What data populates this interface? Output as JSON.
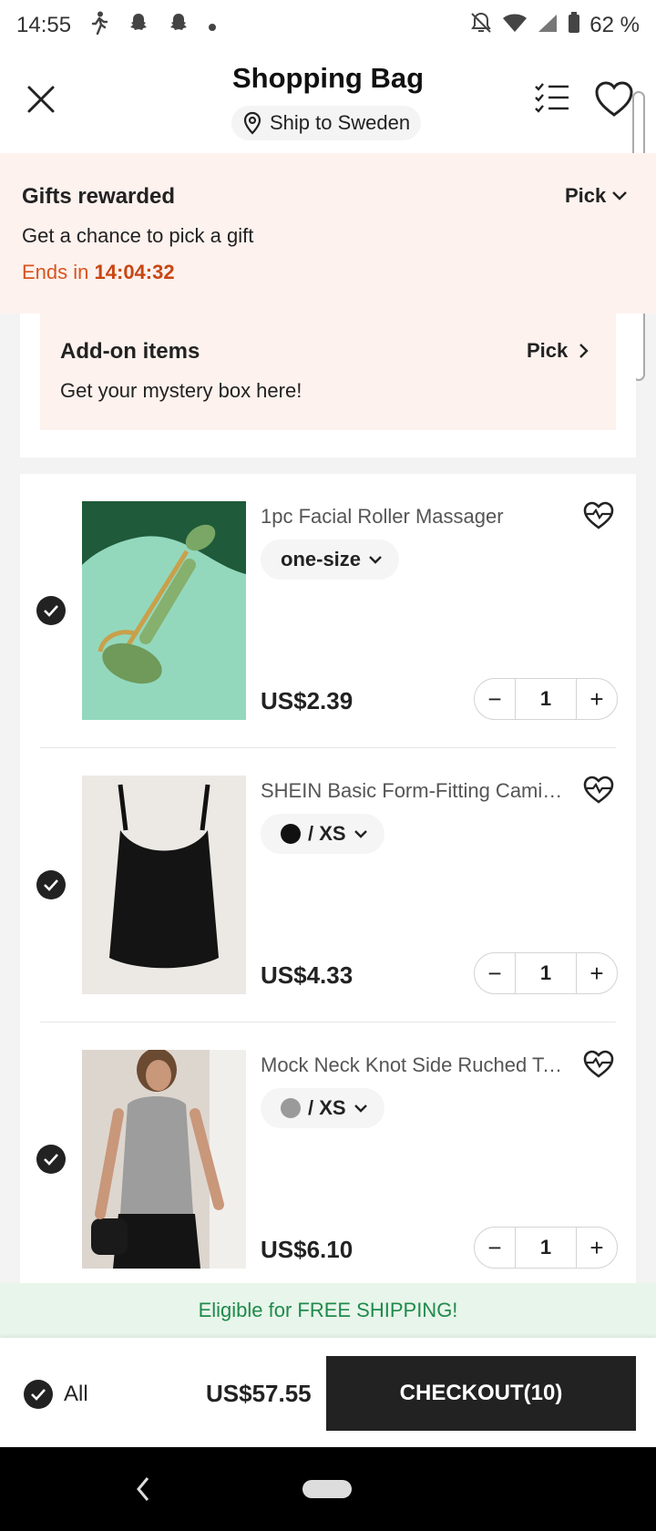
{
  "status_bar": {
    "time": "14:55",
    "battery": "62 %"
  },
  "header": {
    "title": "Shopping Bag",
    "ship_to": "Ship to Sweden"
  },
  "gifts": {
    "title": "Gifts rewarded",
    "subtitle": "Get a chance to pick a gift",
    "ends_label": "Ends in",
    "countdown": "14:04:32",
    "pick_label": "Pick"
  },
  "addon": {
    "title": "Add-on items",
    "subtitle": "Get your mystery box here!",
    "pick_label": "Pick"
  },
  "items": [
    {
      "name": "1pc Facial Roller Massager",
      "variant": "one-size",
      "swatch": "",
      "price": "US$2.39",
      "qty": "1"
    },
    {
      "name": "SHEIN Basic Form-Fitting Cami Top",
      "variant": "/ XS",
      "swatch": "#111111",
      "price": "US$4.33",
      "qty": "1"
    },
    {
      "name": "Mock Neck Knot Side Ruched Tank Top",
      "variant": "/ XS",
      "swatch": "#9a9a9a",
      "price": "US$6.10",
      "qty": "1"
    }
  ],
  "free_shipping": "Eligible for FREE SHIPPING!",
  "bottom": {
    "all_label": "All",
    "total": "US$57.55",
    "checkout_label": "CHECKOUT(10)"
  },
  "colors": {
    "accent_orange": "#d9541f",
    "free_ship_green": "#1f8a4c",
    "banner_bg": "#fdf2ee"
  }
}
